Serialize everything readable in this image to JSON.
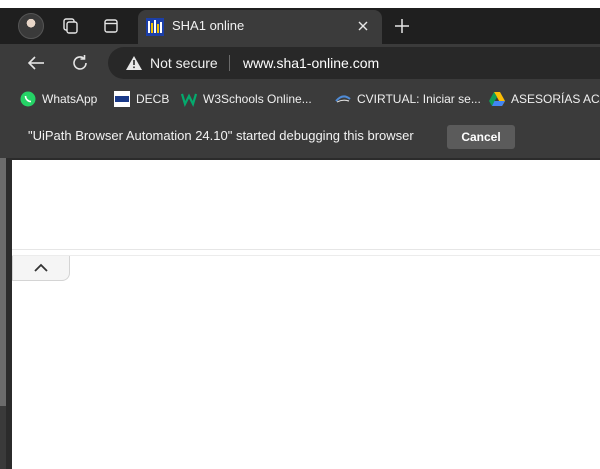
{
  "tab": {
    "title": "SHA1 online"
  },
  "omnibox": {
    "security": "Not secure",
    "url": "www.sha1-online.com"
  },
  "bookmarks": [
    {
      "label": "WhatsApp",
      "icon": "whatsapp-icon"
    },
    {
      "label": "DECB",
      "icon": "decb-icon"
    },
    {
      "label": "W3Schools Online...",
      "icon": "w3schools-icon"
    },
    {
      "label": "CVIRTUAL: Iniciar se...",
      "icon": "cvirtual-icon"
    },
    {
      "label": "ASESORÍAS ACAD",
      "icon": "google-drive-icon"
    }
  ],
  "infobar": {
    "message": "\"UiPath Browser Automation 24.10\" started debugging this browser",
    "cancel_label": "Cancel"
  },
  "colors": {
    "frame": "#1f1f1f",
    "toolbar": "#3b3b3b",
    "omnibox": "#282828",
    "whatsapp": "#25d366",
    "w3schools": "#04aa6d"
  }
}
